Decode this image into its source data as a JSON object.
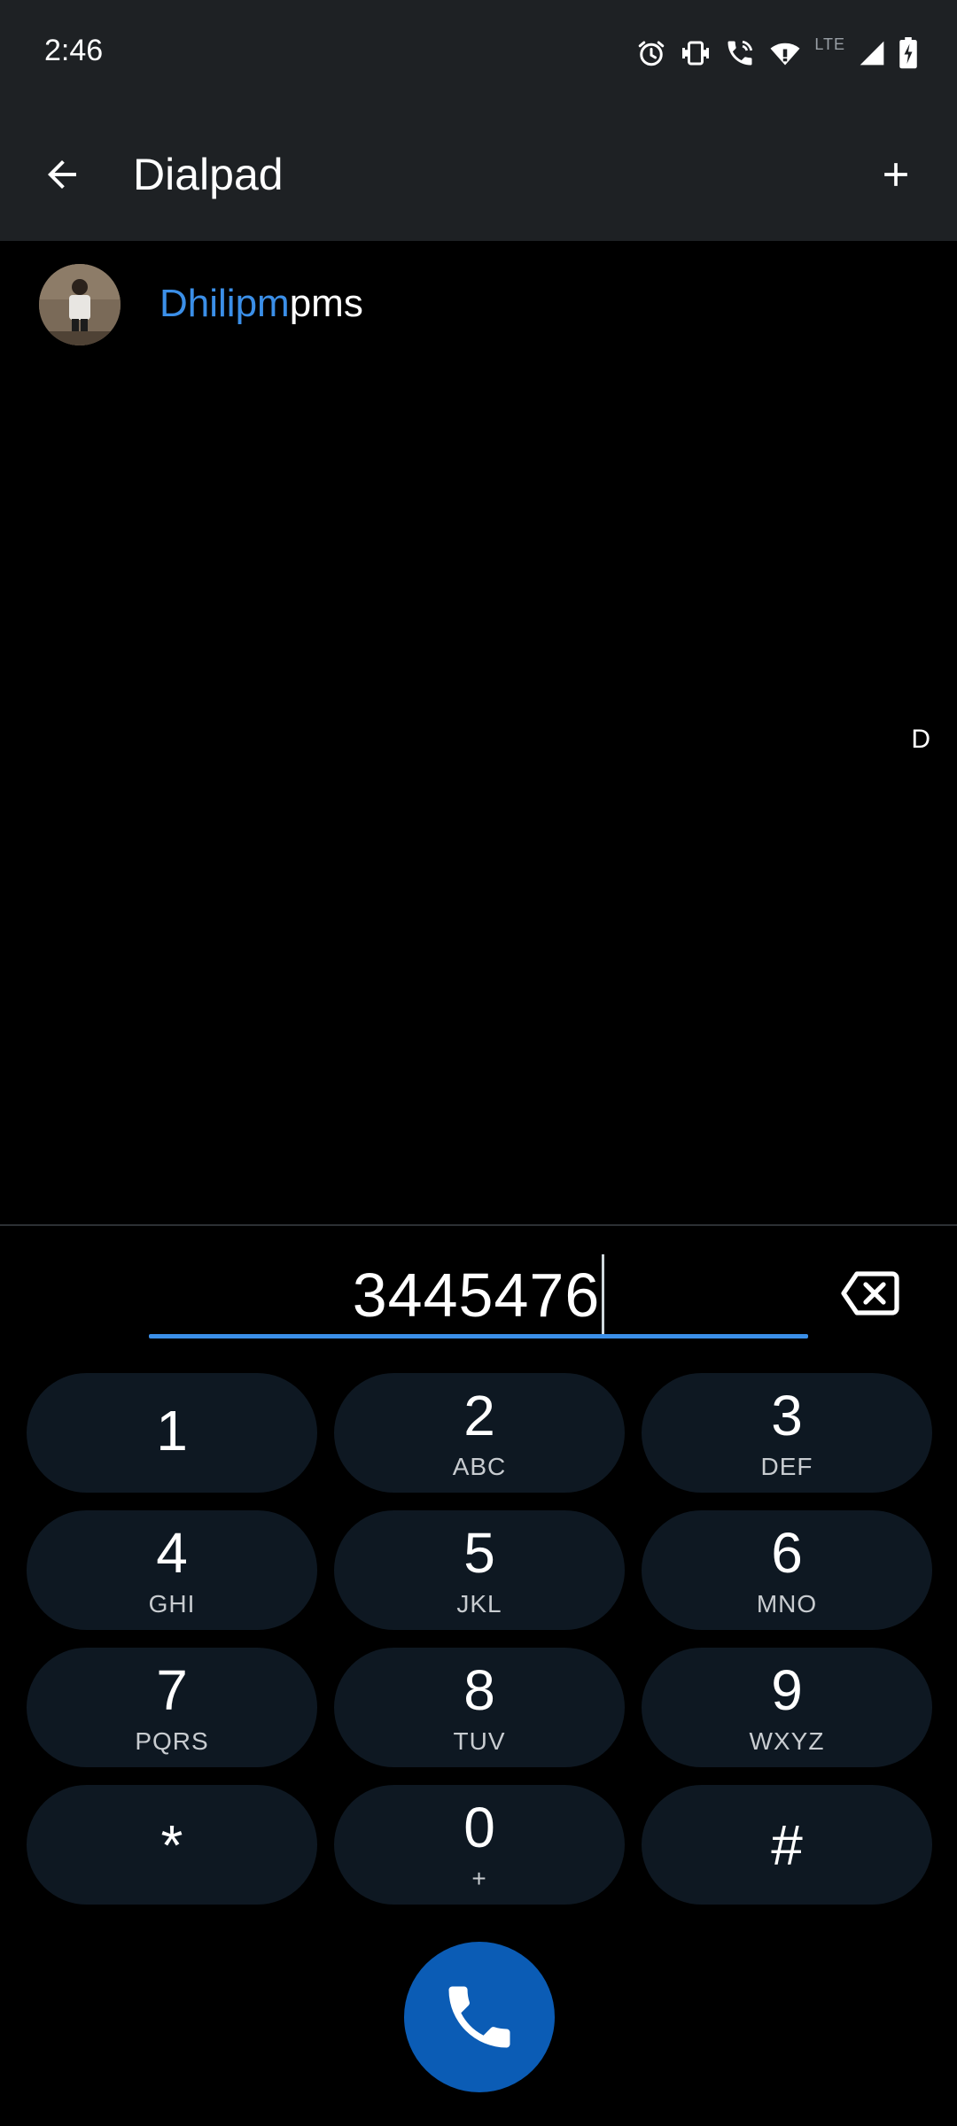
{
  "status_bar": {
    "time": "2:46",
    "network_label": "LTE",
    "icons": [
      "alarm-icon",
      "vibrate-icon",
      "wifi-calling-icon",
      "wifi-icon",
      "signal-icon",
      "battery-charging-icon"
    ]
  },
  "toolbar": {
    "title": "Dialpad",
    "back_icon": "arrow-back-icon",
    "add_icon": "plus-icon"
  },
  "suggestion": {
    "name_match": "Dhilipm",
    "name_rest": "pms",
    "avatar": "contact-photo"
  },
  "fastscroll": {
    "letter": "D"
  },
  "dialpad": {
    "digits": "3445476",
    "backspace_icon": "backspace-icon",
    "keys": [
      {
        "digit": "1",
        "letters": ""
      },
      {
        "digit": "2",
        "letters": "ABC"
      },
      {
        "digit": "3",
        "letters": "DEF"
      },
      {
        "digit": "4",
        "letters": "GHI"
      },
      {
        "digit": "5",
        "letters": "JKL"
      },
      {
        "digit": "6",
        "letters": "MNO"
      },
      {
        "digit": "7",
        "letters": "PQRS"
      },
      {
        "digit": "8",
        "letters": "TUV"
      },
      {
        "digit": "9",
        "letters": "WXYZ"
      },
      {
        "digit": "*",
        "letters": ""
      },
      {
        "digit": "0",
        "letters": "+"
      },
      {
        "digit": "#",
        "letters": ""
      }
    ],
    "call_icon": "phone-icon"
  },
  "colors": {
    "accent": "#3b8fe8",
    "toolbar_bg": "#1e2124",
    "key_bg": "#0e1822",
    "call_button": "#0b5cb5"
  }
}
